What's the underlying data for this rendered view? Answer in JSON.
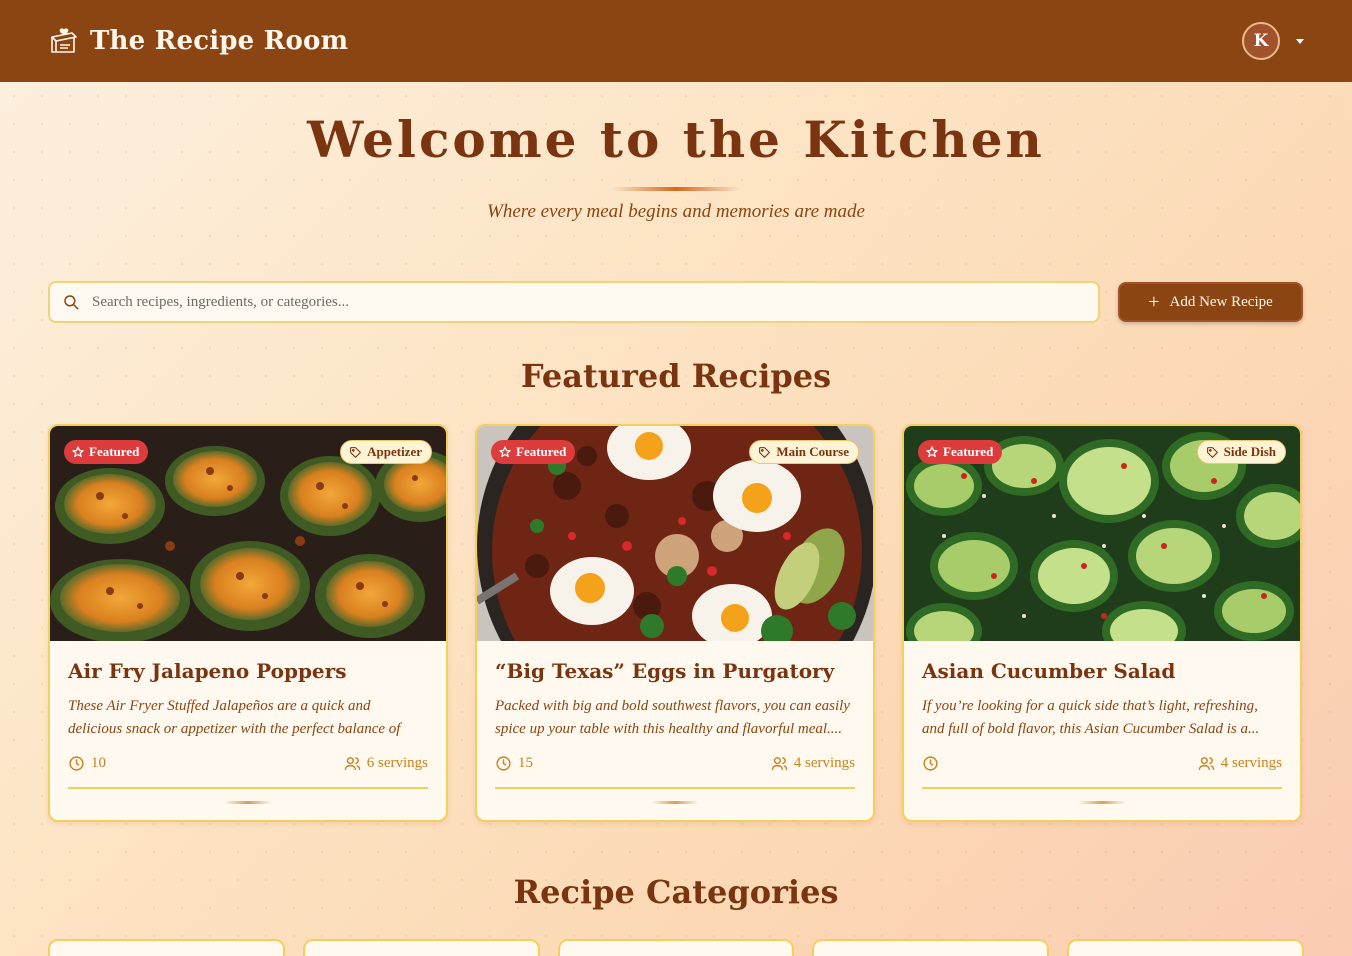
{
  "header": {
    "brand_title": "The Recipe Room",
    "user_initial": "K",
    "brand_color": "#8b4513"
  },
  "hero": {
    "title": "Welcome to the Kitchen",
    "subtitle": "Where every meal begins and memories are made"
  },
  "search": {
    "placeholder": "Search recipes, ingredients, or categories...",
    "value": ""
  },
  "actions": {
    "add_recipe_label": "Add New Recipe"
  },
  "featured": {
    "title": "Featured Recipes",
    "cards": [
      {
        "badge": "Featured",
        "category": "Appetizer",
        "title": "Air Fry Jalapeno Poppers",
        "description": "These Air Fryer Stuffed Jalapeños are a quick and delicious snack or appetizer with the perfect balance of heat,...",
        "time": "10",
        "servings": "6 servings"
      },
      {
        "badge": "Featured",
        "category": "Main Course",
        "title": "“Big Texas” Eggs in Purgatory",
        "description": "Packed with big and bold southwest flavors, you can easily spice up your table with this healthy and flavorful meal....",
        "time": "15",
        "servings": "4 servings"
      },
      {
        "badge": "Featured",
        "category": "Side Dish",
        "title": "Asian Cucumber Salad",
        "description": "If you’re looking for a quick side that’s light, refreshing, and full of bold flavor, this Asian Cucumber Salad is a...",
        "time": "",
        "servings": "4 servings"
      }
    ]
  },
  "categories": {
    "title": "Recipe Categories"
  },
  "colors": {
    "accent": "#8b4513",
    "badge_red": "#dc3c3c",
    "border_gold": "#f4cf5f",
    "meta_orange": "#c8821e"
  }
}
